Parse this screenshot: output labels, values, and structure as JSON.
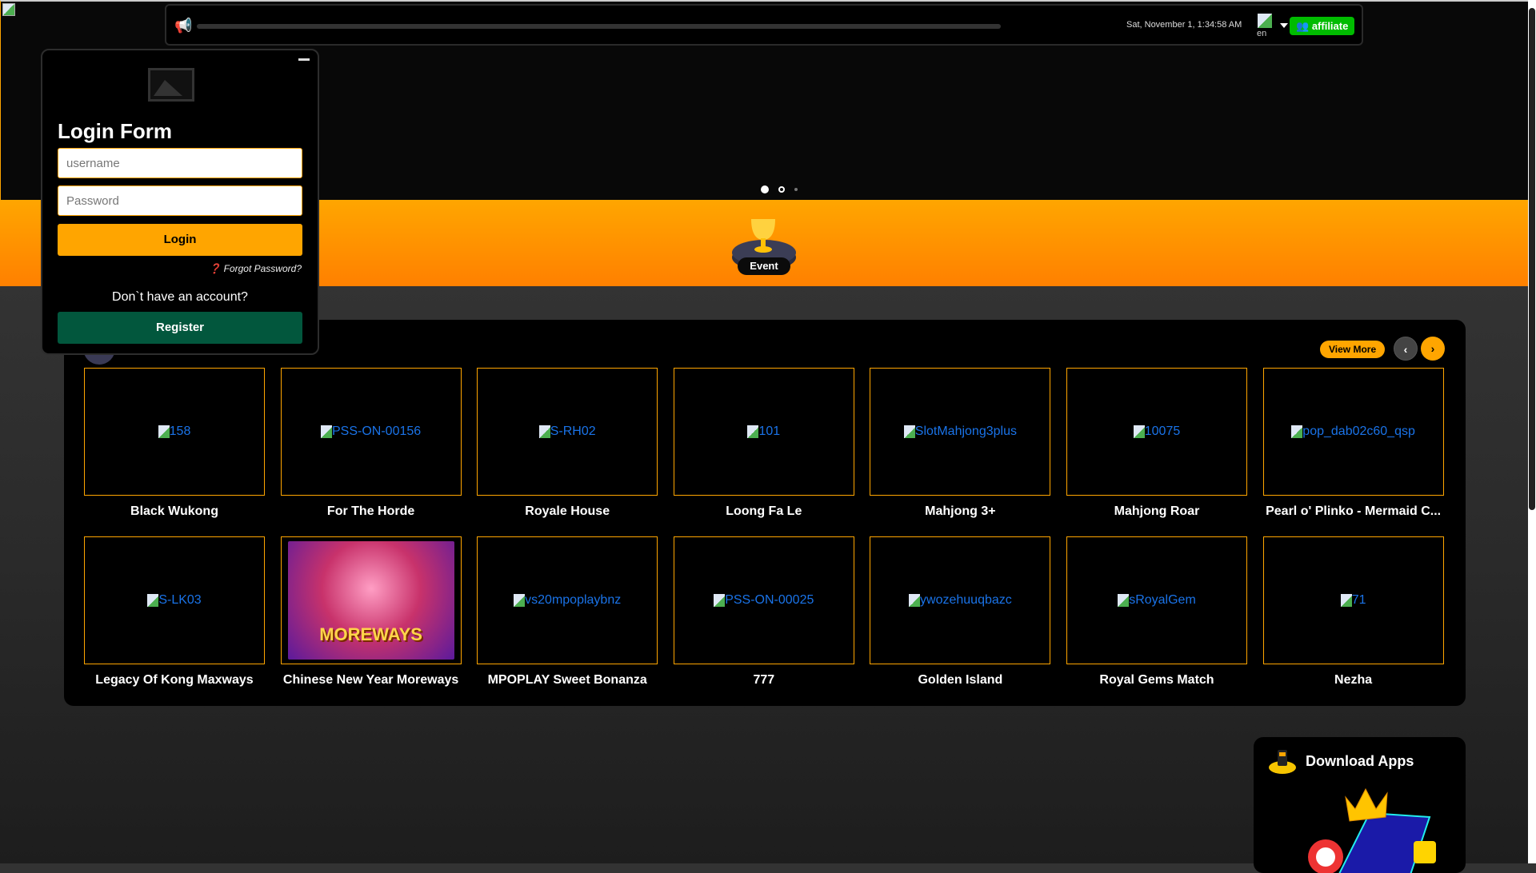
{
  "topbar": {
    "datetime": "Sat, November 1, 1:34:58 AM",
    "language": "en",
    "affiliate_label": "affiliate"
  },
  "carousel": {
    "slide_count": 3,
    "active_slide": 1
  },
  "band": {
    "event_label": "Event"
  },
  "login": {
    "title": "Login Form",
    "username_placeholder": "username",
    "password_placeholder": "Password",
    "login_label": "Login",
    "forgot_label": "Forgot Password?",
    "no_account": "Don`t have an account?",
    "register_label": "Register"
  },
  "games": {
    "view_more": "View More",
    "items": [
      {
        "alt": "158",
        "title": "Black Wukong"
      },
      {
        "alt": "PSS-ON-00156",
        "title": "For The Horde"
      },
      {
        "alt": "S-RH02",
        "title": "Royale House"
      },
      {
        "alt": "101",
        "title": "Loong Fa Le"
      },
      {
        "alt": "SlotMahjong3plus",
        "title": "Mahjong 3+"
      },
      {
        "alt": "10075",
        "title": "Mahjong Roar"
      },
      {
        "alt": "pop_dab02c60_qsp",
        "title": "Pearl o' Plinko - Mermaid C..."
      },
      {
        "alt": "S-LK03",
        "title": "Legacy Of Kong Maxways"
      },
      {
        "alt": "",
        "title": "Chinese New Year Moreways",
        "art_text": "MOREWAYS"
      },
      {
        "alt": "vs20mpoplaybnz",
        "title": "MPOPLAY Sweet Bonanza"
      },
      {
        "alt": "PSS-ON-00025",
        "title": "777"
      },
      {
        "alt": "ywozehuuqbazc",
        "title": "Golden Island"
      },
      {
        "alt": "sRoyalGem",
        "title": "Royal Gems Match"
      },
      {
        "alt": "71",
        "title": "Nezha"
      }
    ]
  },
  "download": {
    "title": "Download Apps"
  },
  "colors": {
    "accent": "#ffa500",
    "affiliate": "#00bb00",
    "register": "#02573d"
  }
}
